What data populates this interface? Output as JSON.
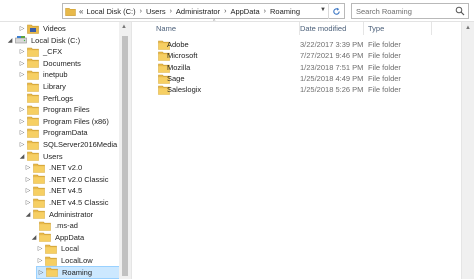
{
  "address_bar": {
    "crumbs": [
      "Local Disk (C:)",
      "Users",
      "Administrator",
      "AppData",
      "Roaming"
    ],
    "search_placeholder": "Search Roaming"
  },
  "nav_tree": [
    {
      "label": "Videos",
      "arrow": "collapsed",
      "icon": "video-folder"
    },
    {
      "label": "Local Disk (C:)",
      "arrow": "expanded",
      "icon": "drive"
    },
    {
      "label": "_CFX",
      "arrow": "collapsed",
      "icon": "folder"
    },
    {
      "label": "Documents",
      "arrow": "collapsed",
      "icon": "folder"
    },
    {
      "label": "inetpub",
      "arrow": "collapsed",
      "icon": "folder"
    },
    {
      "label": "Library",
      "arrow": "none",
      "icon": "folder"
    },
    {
      "label": "PerfLogs",
      "arrow": "none",
      "icon": "folder"
    },
    {
      "label": "Program Files",
      "arrow": "collapsed",
      "icon": "folder"
    },
    {
      "label": "Program Files (x86)",
      "arrow": "collapsed",
      "icon": "folder"
    },
    {
      "label": "ProgramData",
      "arrow": "collapsed",
      "icon": "folder"
    },
    {
      "label": "SQLServer2016Media",
      "arrow": "collapsed",
      "icon": "folder"
    },
    {
      "label": "Users",
      "arrow": "expanded",
      "icon": "folder"
    },
    {
      "label": ".NET v2.0",
      "arrow": "collapsed",
      "icon": "folder"
    },
    {
      "label": ".NET v2.0 Classic",
      "arrow": "collapsed",
      "icon": "folder"
    },
    {
      "label": ".NET v4.5",
      "arrow": "collapsed",
      "icon": "folder"
    },
    {
      "label": ".NET v4.5 Classic",
      "arrow": "collapsed",
      "icon": "folder"
    },
    {
      "label": "Administrator",
      "arrow": "expanded",
      "icon": "folder"
    },
    {
      "label": ".ms-ad",
      "arrow": "none",
      "icon": "folder"
    },
    {
      "label": "AppData",
      "arrow": "expanded",
      "icon": "folder"
    },
    {
      "label": "Local",
      "arrow": "collapsed",
      "icon": "folder"
    },
    {
      "label": "LocalLow",
      "arrow": "collapsed",
      "icon": "folder"
    },
    {
      "label": "Roaming",
      "arrow": "collapsed",
      "icon": "folder",
      "selected": true
    }
  ],
  "columns": {
    "name": "Name",
    "date": "Date modified",
    "type": "Type"
  },
  "files": [
    {
      "name": "Adobe",
      "date": "3/22/2017 3:39 PM",
      "type": "File folder"
    },
    {
      "name": "Microsoft",
      "date": "7/27/2021 9:46 PM",
      "type": "File folder"
    },
    {
      "name": "Mozilla",
      "date": "1/23/2018 7:51 PM",
      "type": "File folder"
    },
    {
      "name": "Sage",
      "date": "1/25/2018 4:49 PM",
      "type": "File folder"
    },
    {
      "name": "Saleslogix",
      "date": "1/25/2018 5:26 PM",
      "type": "File folder"
    }
  ],
  "colors": {
    "folder": "#e8b94a",
    "selection": "#cce8ff",
    "header_text": "#4c607a"
  }
}
